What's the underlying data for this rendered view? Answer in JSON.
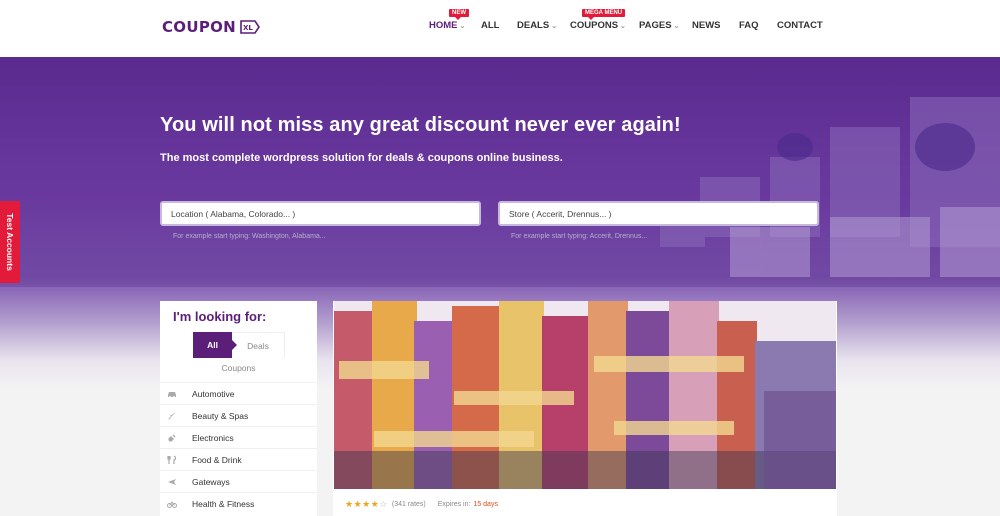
{
  "logo": {
    "text": "COUPON",
    "badge": "XL"
  },
  "nav": {
    "items": [
      {
        "label": "HOME",
        "caret": true,
        "badge": "NEW",
        "active": true
      },
      {
        "label": "ALL",
        "caret": false
      },
      {
        "label": "DEALS",
        "caret": true
      },
      {
        "label": "COUPONS",
        "caret": true,
        "badge": "MEGA MENU"
      },
      {
        "label": "PAGES",
        "caret": true
      },
      {
        "label": "NEWS",
        "caret": false
      },
      {
        "label": "FAQ",
        "caret": false
      },
      {
        "label": "CONTACT",
        "caret": false
      }
    ]
  },
  "hero": {
    "title": "You will not miss any great discount never ever again!",
    "subtitle": "The most complete wordpress solution for deals & coupons online business.",
    "location_placeholder": "Location ( Alabama, Colorado... )",
    "location_hint": "For example start typing: Washington, Alabama...",
    "store_placeholder": "Store ( Accerit, Drennus... )",
    "store_hint": "For example start typing: Accerit, Drennus..."
  },
  "side_tab": {
    "label": "Test Accounts"
  },
  "filter": {
    "title": "I'm looking for:",
    "tabs": {
      "all": "All",
      "deals": "Deals",
      "coupons": "Coupons"
    },
    "categories": [
      {
        "icon": "car-icon",
        "label": "Automotive"
      },
      {
        "icon": "brush-icon",
        "label": "Beauty & Spas"
      },
      {
        "icon": "plug-icon",
        "label": "Electronics"
      },
      {
        "icon": "cutlery-icon",
        "label": "Food & Drink"
      },
      {
        "icon": "plane-icon",
        "label": "Gateways"
      },
      {
        "icon": "bike-icon",
        "label": "Health & Fitness"
      }
    ]
  },
  "deal": {
    "rating": 4,
    "rates": "(341 rates)",
    "expires_label": "Expires in:",
    "expires_value": "15 days"
  },
  "colors": {
    "brand": "#5b1f7a",
    "accent_red": "#e31b3a",
    "star": "#f2a31b"
  }
}
